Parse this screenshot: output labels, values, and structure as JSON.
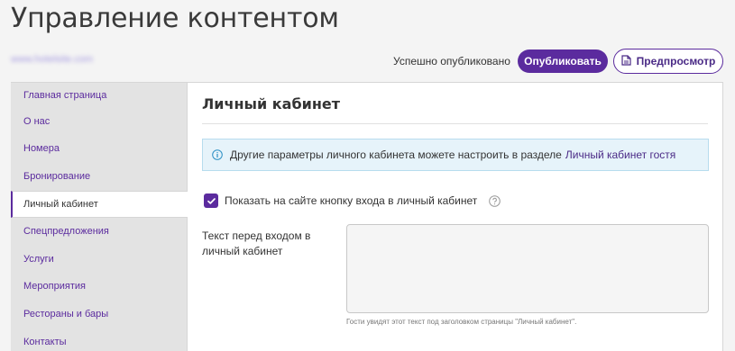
{
  "page": {
    "title": "Управление контентом",
    "site_link": "www.hotelsite.com"
  },
  "header": {
    "status": "Успешно опубликовано",
    "publish_label": "Опубликовать",
    "preview_label": "Предпросмотр"
  },
  "colors": {
    "accent": "#5b2b9e",
    "info_bg": "#e6f3fa"
  },
  "sidebar": {
    "items": [
      {
        "label": "Главная страница",
        "active": false
      },
      {
        "label": "О нас",
        "active": false
      },
      {
        "label": "Номера",
        "active": false
      },
      {
        "label": "Бронирование",
        "active": false
      },
      {
        "label": "Личный кабинет",
        "active": true
      },
      {
        "label": "Спецпредложения",
        "active": false
      },
      {
        "label": "Услуги",
        "active": false
      },
      {
        "label": "Мероприятия",
        "active": false
      },
      {
        "label": "Рестораны и бары",
        "active": false
      },
      {
        "label": "Контакты",
        "active": false
      }
    ]
  },
  "main": {
    "section_title": "Личный кабинет",
    "info": {
      "icon": "info-icon",
      "text": "Другие параметры личного кабинета можете настроить в разделе",
      "link": "Личный кабинет гостя"
    },
    "show_login_checkbox": {
      "label": "Показать на сайте кнопку входа в личный кабинет",
      "checked": true
    },
    "pre_login_text": {
      "label": "Текст перед входом в личный кабинет",
      "value": "",
      "hint": "Гости увидят этот текст под заголовком страницы \"Личный кабинет\"."
    }
  }
}
